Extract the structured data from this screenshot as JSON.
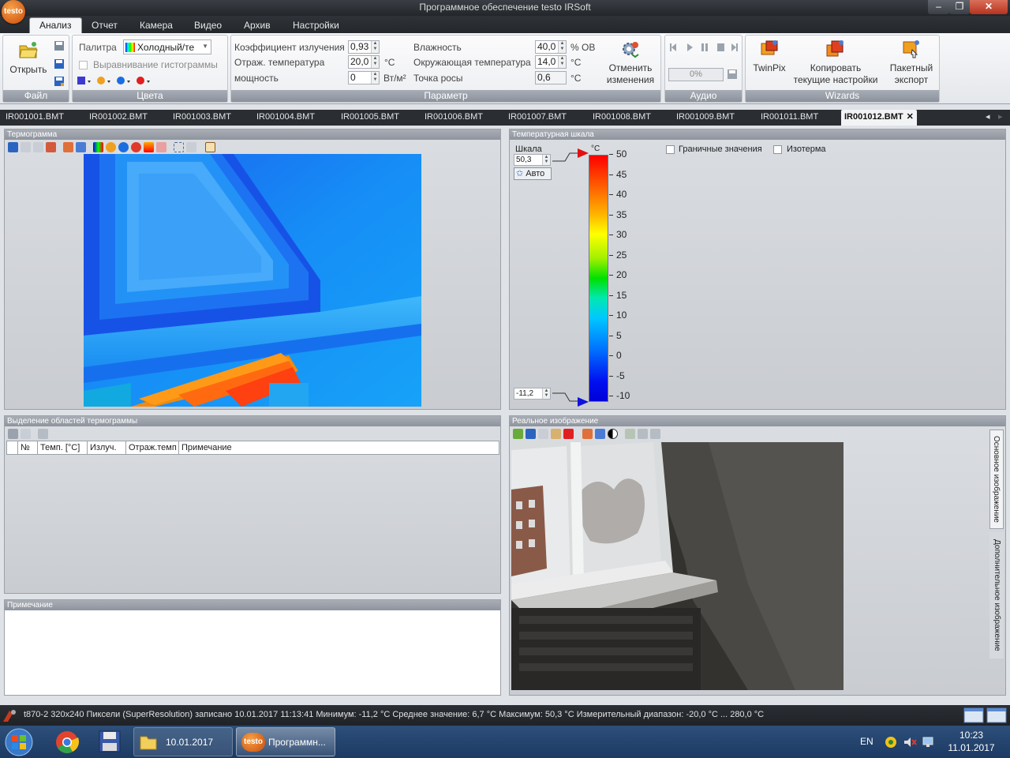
{
  "window": {
    "title": "Программное обеспечение testo IRSoft",
    "logo_text": "testo",
    "minimize": "–",
    "maximize": "❐",
    "close": "✕"
  },
  "menu": {
    "tabs": [
      "Анализ",
      "Отчет",
      "Камера",
      "Видео",
      "Архив",
      "Настройки"
    ]
  },
  "ribbon": {
    "file": {
      "open_label": "Открыть",
      "group_label": "Файл"
    },
    "colors": {
      "palette_label": "Палитра",
      "palette_value": "Холодный/те",
      "histogram_label": "Выравнивание гистограммы",
      "group_label": "Цвета"
    },
    "params": {
      "emissivity_label": "Коэффициент излучения",
      "emissivity_value": "0,93",
      "refl_temp_label": "Отраж. температура",
      "refl_temp_value": "20,0",
      "refl_temp_unit": "°C",
      "power_label": "мощность",
      "power_value": "0",
      "power_unit": "Вт/м²",
      "humidity_label": "Влажность",
      "humidity_value": "40,0",
      "humidity_unit": "% ОВ",
      "ambient_label": "Окружающая температура",
      "ambient_value": "14,0",
      "ambient_unit": "°C",
      "dew_label": "Точка росы",
      "dew_value": "0,6",
      "dew_unit": "°C",
      "undo_label_1": "Отменить",
      "undo_label_2": "изменения",
      "group_label": "Параметр"
    },
    "audio": {
      "progress": "0%",
      "progress_value": 0,
      "group_label": "Аудио"
    },
    "wizards": {
      "twinpix_label": "TwinPix",
      "copy_label_1": "Копировать",
      "copy_label_2": "текущие настройки",
      "batch_label_1": "Пакетный",
      "batch_label_2": "экспорт",
      "group_label": "Wizards"
    }
  },
  "file_tabs": [
    "IR001001.BMT",
    "IR001002.BMT",
    "IR001003.BMT",
    "IR001004.BMT",
    "IR001005.BMT",
    "IR001006.BMT",
    "IR001007.BMT",
    "IR001008.BMT",
    "IR001009.BMT",
    "IR001011.BMT",
    "IR001012.BMT"
  ],
  "active_file_tab": "IR001012.BMT",
  "panels": {
    "thermogram_title": "Термограмма",
    "scale_title": "Температурная шкала",
    "areas_title": "Выделение областей термограммы",
    "note_title": "Примечание",
    "real_title": "Реальное изображение"
  },
  "scale": {
    "label": "Шкала",
    "max_value": "50,3",
    "min_value": "-11,2",
    "auto_label": "Авто",
    "unit": "°C",
    "ticks": [
      "50",
      "45",
      "40",
      "35",
      "30",
      "25",
      "20",
      "15",
      "10",
      "5",
      "0",
      "-5",
      "-10"
    ],
    "limits_label": "Граничные значения",
    "isotherm_label": "Изотерма"
  },
  "areas_table": {
    "columns": [
      "№",
      "Темп. [°C]",
      "Излуч.",
      "Отраж.темп",
      "Примечание"
    ]
  },
  "side_tabs": {
    "main": "Основное изображение",
    "extra": "Дополнительное изображение"
  },
  "status": {
    "text": "t870-2  320x240  Пиксели (SuperResolution)  записано  10.01.2017  11:13:41   Минимум:  -11,2 °C  Среднее значение:  6,7 °C  Максимум:  50,3 °C   Измерительный диапазон:  -20,0 °C ... 280,0 °C"
  },
  "taskbar": {
    "folder_label": "10.01.2017",
    "app_label": "Программн...",
    "app_badge": "testo",
    "lang": "EN",
    "time": "10:23",
    "date": "11.01.2017"
  }
}
